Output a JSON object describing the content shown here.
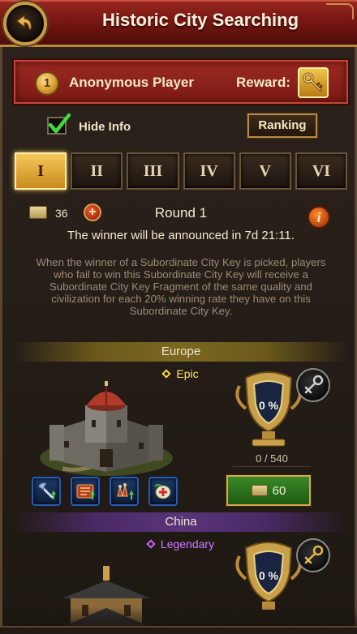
{
  "header": {
    "title": "Historic City Searching",
    "back_icon": "back-arrow-icon"
  },
  "player": {
    "rank": "1",
    "name": "Anonymous Player",
    "reward_label": "Reward:",
    "reward_icon": "golden-key-icon"
  },
  "options": {
    "hide_info_label": "Hide Info",
    "hide_info_checked": true,
    "ranking_label": "Ranking"
  },
  "tabs": [
    {
      "label": "I",
      "active": true
    },
    {
      "label": "II",
      "active": false
    },
    {
      "label": "III",
      "active": false
    },
    {
      "label": "IV",
      "active": false
    },
    {
      "label": "V",
      "active": false
    },
    {
      "label": "VI",
      "active": false
    }
  ],
  "round": {
    "map_count": "36",
    "title": "Round 1",
    "announcement": "The winner will be announced in 7d 21:11."
  },
  "description": "When the winner of a Subordinate City Key is picked, players who fail to win this Subordinate City Key will receive a Subordinate City Key Fragment of the same quality and civilization for each 20% winning rate they have on this Subordinate City Key.",
  "cities": [
    {
      "region": "Europe",
      "quality": "Epic",
      "win_rate": "0 %",
      "progress": "0 / 540",
      "bid_cost": "60",
      "items": [
        "axe-upgrade-icon",
        "book-scroll-icon",
        "troop-boost-icon",
        "healing-cross-icon"
      ],
      "colors": {
        "region_bar": "#7a6820",
        "quality": "#ffe55a"
      }
    },
    {
      "region": "China",
      "quality": "Legendary",
      "win_rate": "0 %",
      "colors": {
        "region_bar": "#5a3478",
        "quality": "#d07bff"
      }
    }
  ]
}
